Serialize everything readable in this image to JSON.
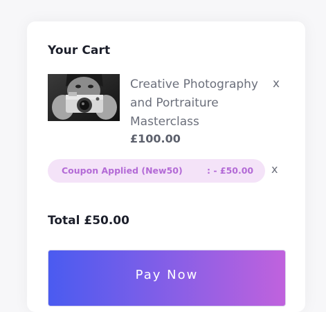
{
  "cart": {
    "title": "Your Cart",
    "item": {
      "image": "camera-photographer-thumbnail",
      "name": "Creative Photography and Portraiture Masterclass",
      "price": "£100.00",
      "remove_label": "x"
    },
    "coupon": {
      "label": "Coupon Applied (New50)",
      "amount": ": - £50.00",
      "remove_label": "x"
    },
    "total": "Total £50.00",
    "pay_label": "Pay Now"
  },
  "colors": {
    "coupon_bg": "#f4e3f8",
    "coupon_text": "#b36ad6",
    "button_gradient_start": "#4a5bf0",
    "button_gradient_end": "#c062dd"
  }
}
